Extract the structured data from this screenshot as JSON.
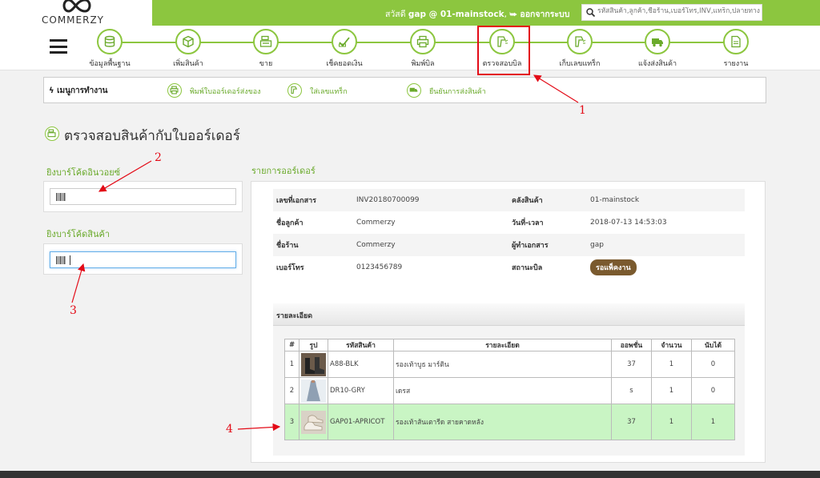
{
  "brand": {
    "name": "COMMERZY",
    "accent": "#8cc63f",
    "annotation_color": "#e30b17"
  },
  "header": {
    "greeting": "สวัสดี",
    "username": "gap @ 01-mainstock",
    "logout": "ออกจากระบบ",
    "search_placeholder": "รหัสสินค้า,ลูกค้า,ชื่อร้าน,เบอร์โทร,INV,แทร็ก,ปลายทาง"
  },
  "nav": {
    "items": [
      {
        "label": "ข้อมูลพื้นฐาน",
        "icon": "database-icon"
      },
      {
        "label": "เพิ่มสินค้า",
        "icon": "box-icon"
      },
      {
        "label": "ขาย",
        "icon": "cash-register-icon"
      },
      {
        "label": "เช็คยอดเงิน",
        "icon": "money-check-icon"
      },
      {
        "label": "พิมพ์บิล",
        "icon": "printer-icon"
      },
      {
        "label": "ตรวจสอบบิล",
        "icon": "barcode-scanner-icon"
      },
      {
        "label": "เก็บเลขแทร็ก",
        "icon": "barcode-scanner-icon"
      },
      {
        "label": "แจ้งส่งสินค้า",
        "icon": "truck-icon"
      },
      {
        "label": "รายงาน",
        "icon": "report-icon"
      }
    ]
  },
  "workmenu": {
    "title": "เมนูการทำงาน",
    "items": [
      {
        "label": "พิมพ์ใบออร์เดอร์ส่งของ",
        "icon": "printer-icon"
      },
      {
        "label": "ใส่เลขแทร็ก",
        "icon": "barcode-scanner-icon"
      },
      {
        "label": "ยืนยันการส่งสินค้า",
        "icon": "truck-icon"
      }
    ]
  },
  "page_title": "ตรวจสอบสินค้ากับใบออร์เดอร์",
  "scan": {
    "invoice_label": "ยิงบาร์โค้ดอินวอยซ์",
    "invoice_value": "",
    "product_label": "ยิงบาร์โค้ดสินค้า",
    "product_value": ""
  },
  "order": {
    "section_label": "รายการออร์เดอร์",
    "info": [
      {
        "k1": "เลขที่เอกสาร",
        "v1": "INV20180700099",
        "k2": "คลังสินค้า",
        "v2": "01-mainstock"
      },
      {
        "k1": "ชื่อลูกค้า",
        "v1": "Commerzy",
        "k2": "วันที่-เวลา",
        "v2": "2018-07-13 14:53:03"
      },
      {
        "k1": "ชื่อร้าน",
        "v1": "Commerzy",
        "k2": "ผู้ทำเอกสาร",
        "v2": "gap"
      },
      {
        "k1": "เบอร์โทร",
        "v1": "0123456789",
        "k2": "สถานะบิล",
        "v2": "รอแพ็คงาน"
      }
    ],
    "detail_label": "รายละเอียด",
    "columns": [
      "#",
      "รูป",
      "รหัสสินค้า",
      "รายละเอียด",
      "ออพชั่น",
      "จำนวน",
      "นับได้"
    ],
    "rows": [
      {
        "no": "1",
        "code": "A88-BLK",
        "desc": "รองเท้าบูธ มาร์ติน",
        "option": "37",
        "qty": "1",
        "counted": "0"
      },
      {
        "no": "2",
        "code": "DR10-GRY",
        "desc": "เดรส",
        "option": "s",
        "qty": "1",
        "counted": "0"
      },
      {
        "no": "3",
        "code": "GAP01-APRICOT",
        "desc": "รองเท้าส้นเตารีด สายคาดหลัง",
        "option": "37",
        "qty": "1",
        "counted": "1"
      }
    ]
  },
  "annotations": [
    "1",
    "2",
    "3",
    "4"
  ]
}
